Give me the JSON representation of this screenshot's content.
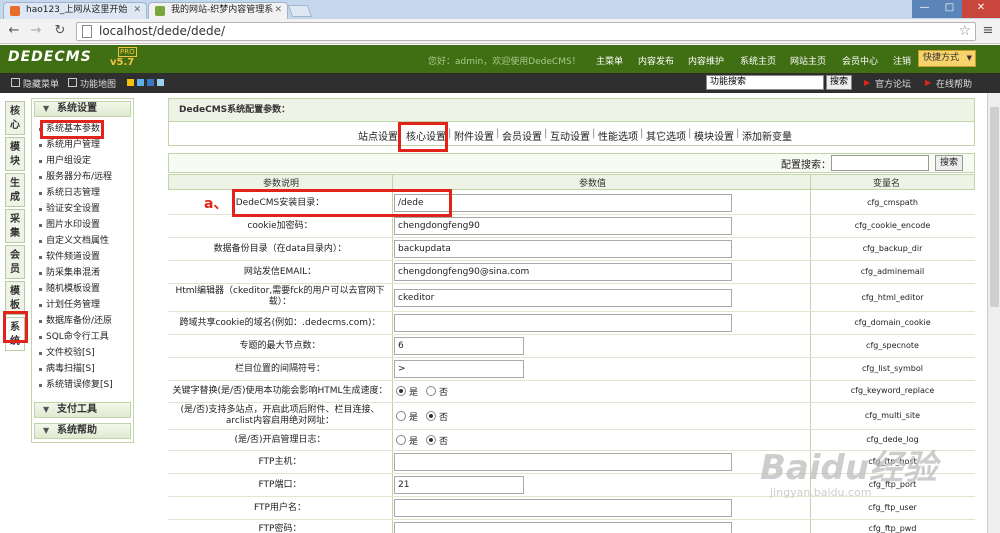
{
  "browser": {
    "tabs": [
      {
        "title": "hao123_上网从这里开始"
      },
      {
        "title": "我的网站-织梦内容管理系"
      }
    ],
    "url": "localhost/dede/dede/"
  },
  "header": {
    "logo": "DEDECMS",
    "version": "v5.7",
    "edition": "PRO",
    "welcome": "您好：admin，欢迎使用DedeCMS！",
    "nav": [
      "主菜单",
      "内容发布",
      "内容维护",
      "系统主页",
      "网站主页",
      "会员中心",
      "注销"
    ],
    "quick": "快捷方式"
  },
  "subbar": {
    "hide_menu": "隐藏菜单",
    "func_map": "功能地图",
    "search_value": "功能搜索",
    "search_button": "搜索",
    "forum": "官方论坛",
    "help": "在线帮助"
  },
  "vtabs": [
    "核心",
    "模块",
    "生成",
    "采集",
    "会员",
    "模板",
    "系统"
  ],
  "sidebar": {
    "group1": "系统设置",
    "items": [
      "系统基本参数",
      "系统用户管理",
      "用户组设定",
      "服务器分布/远程",
      "系统日志管理",
      "验证安全设置",
      "图片水印设置",
      "自定义文档属性",
      "软件频道设置",
      "防采集串混淆",
      "随机模板设置",
      "计划任务管理",
      "数据库备份/还原",
      "SQL命令行工具",
      "文件校验[S]",
      "病毒扫描[S]",
      "系统错误修复[S]"
    ],
    "group2": "支付工具",
    "group3": "系统帮助"
  },
  "main": {
    "title": "DedeCMS系统配置参数：",
    "tabs": [
      "站点设置",
      "核心设置",
      "附件设置",
      "会员设置",
      "互动设置",
      "性能选项",
      "其它选项",
      "模块设置",
      "添加新变量"
    ],
    "search_label": "配置搜索：",
    "search_button": "搜索",
    "columns": [
      "参数说明",
      "参数值",
      "变量名"
    ],
    "annotation": "a、",
    "rows": [
      {
        "label": "DedeCMS安装目录：",
        "value": "/dede",
        "var": "cfg_cmspath"
      },
      {
        "label": "cookie加密码：",
        "value": "chengdongfeng90",
        "var": "cfg_cookie_encode"
      },
      {
        "label": "数据备份目录（在data目录内）：",
        "value": "backupdata",
        "var": "cfg_backup_dir"
      },
      {
        "label": "网站发信EMAIL：",
        "value": "chengdongfeng90@sina.com",
        "var": "cfg_adminemail"
      },
      {
        "label": "Html编辑器（ckeditor,需要fck的用户可以去官网下载）：",
        "value": "ckeditor",
        "var": "cfg_html_editor"
      },
      {
        "label": "跨域共享cookie的域名(例如：.dedecms.com)：",
        "value": "",
        "var": "cfg_domain_cookie"
      },
      {
        "label": "专题的最大节点数：",
        "value": "6",
        "var": "cfg_specnote"
      },
      {
        "label": "栏目位置的间隔符号：",
        "value": ">",
        "var": "cfg_list_symbol"
      },
      {
        "label": "关键字替换(是/否)使用本功能会影响HTML生成速度：",
        "yes": "是",
        "no": "否",
        "var": "cfg_keyword_replace"
      },
      {
        "label": "(是/否)支持多站点，开启此项后附件、栏目连接、arclist内容启用绝对网址：",
        "yes": "是",
        "no": "否",
        "var": "cfg_multi_site"
      },
      {
        "label": "(是/否)开启管理日志：",
        "yes": "是",
        "no": "否",
        "var": "cfg_dede_log"
      },
      {
        "label": "FTP主机：",
        "value": "",
        "var": "cfg_ftp_host"
      },
      {
        "label": "FTP端口：",
        "value": "21",
        "var": "cfg_ftp_port"
      },
      {
        "label": "FTP用户名：",
        "value": "",
        "var": "cfg_ftp_user"
      },
      {
        "label": "FTP密码：",
        "value": "",
        "var": "cfg_ftp_pwd"
      }
    ]
  },
  "watermark": {
    "line1": "Baidu经验",
    "line2": "jingyan.baidu.com"
  }
}
